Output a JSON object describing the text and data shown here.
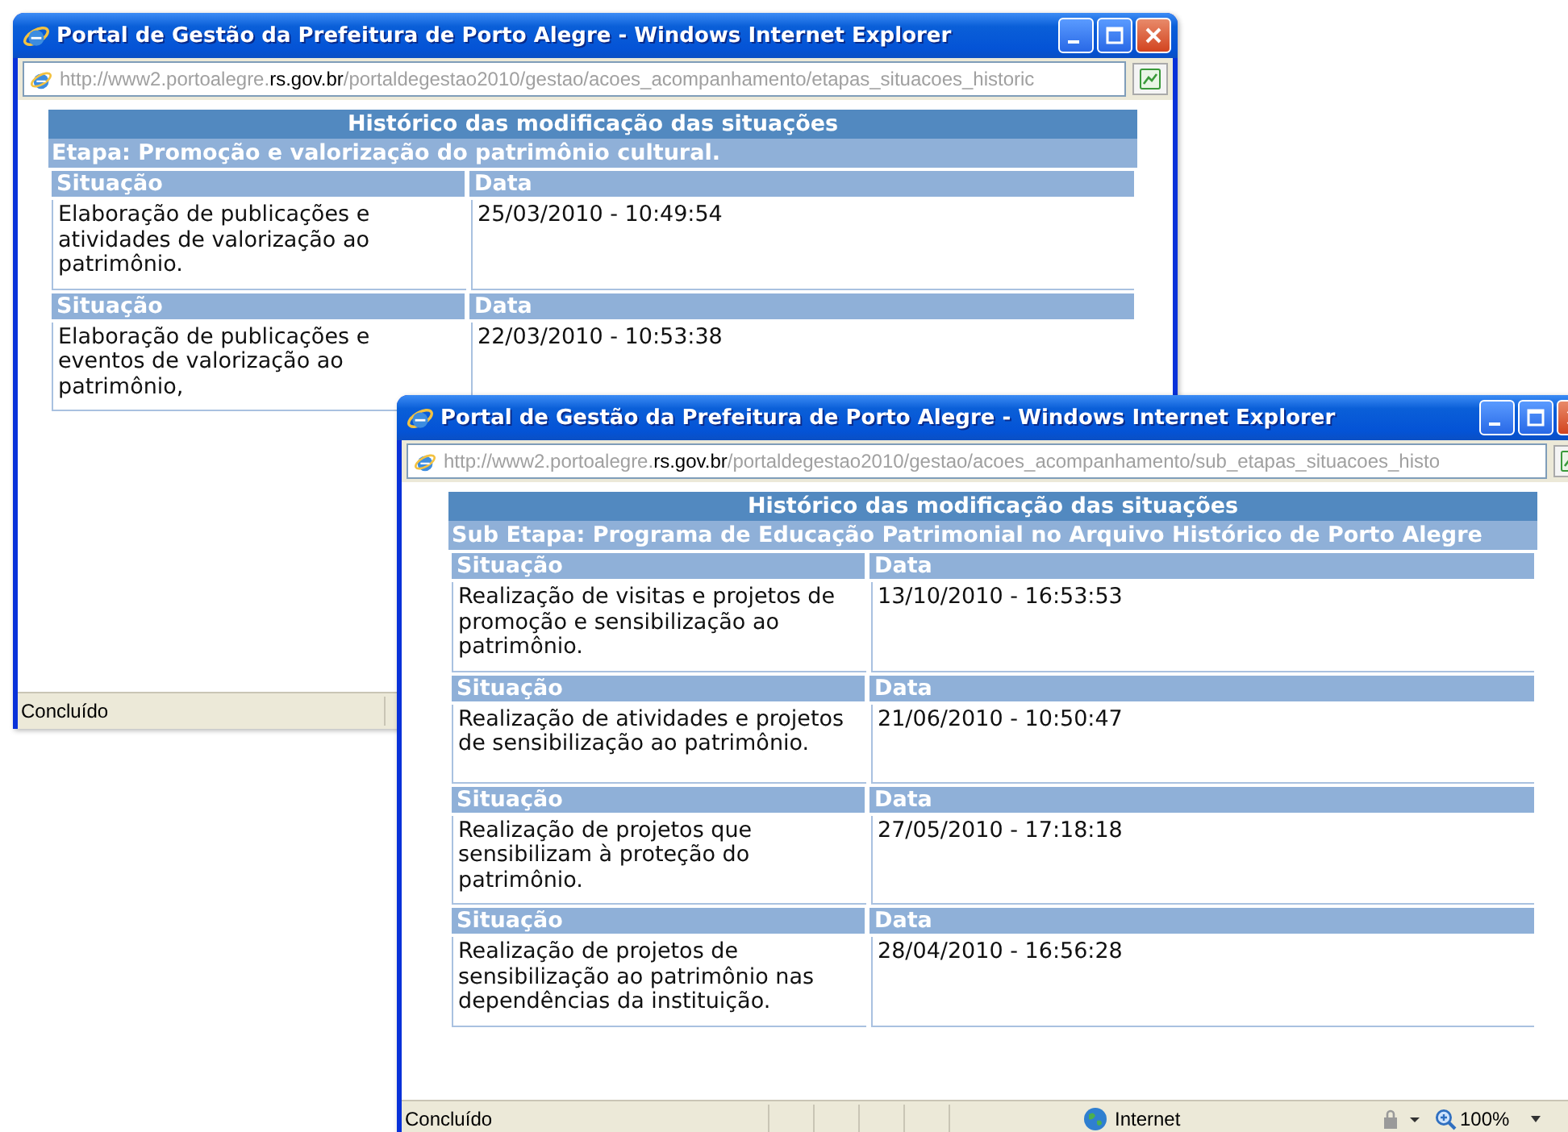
{
  "windows": [
    {
      "title": "Portal de Gestão da Prefeitura de Porto Alegre - Windows Internet Explorer",
      "address": {
        "prefix": "http://www2.portoalegre.",
        "domain": "rs.gov.br",
        "path": "/portaldegestao2010/gestao/acoes_acompanhamento/etapas_situacoes_historic"
      },
      "heading": "Histórico das modificação das situações",
      "stage": "Etapa: Promoção e valorização do patrimônio cultural.",
      "entries": [
        {
          "situation_label": "Situação",
          "date_label": "Data",
          "situation": "Elaboração de publicações e atividades de valorização ao patrimônio.",
          "date": "25/03/2010 - 10:49:54"
        },
        {
          "situation_label": "Situação",
          "date_label": "Data",
          "situation": "Elaboração de publicações e eventos de valorização ao patrimônio,",
          "date": "22/03/2010 - 10:53:38"
        }
      ],
      "status_bar": {
        "text": "Concluído"
      }
    },
    {
      "title": "Portal de Gestão da Prefeitura de Porto Alegre - Windows Internet Explorer",
      "address": {
        "prefix": "http://www2.portoalegre.",
        "domain": "rs.gov.br",
        "path": "/portaldegestao2010/gestao/acoes_acompanhamento/sub_etapas_situacoes_histo"
      },
      "heading": "Histórico das modificação das situações",
      "stage": "Sub Etapa: Programa de Educação Patrimonial no Arquivo Histórico de Porto Alegre",
      "entries": [
        {
          "situation_label": "Situação",
          "date_label": "Data",
          "situation": "Realização de visitas e projetos de promoção e sensibilização ao patrimônio.",
          "date": "13/10/2010 - 16:53:53"
        },
        {
          "situation_label": "Situação",
          "date_label": "Data",
          "situation": "Realização de atividades e projetos de sensibilização ao patrimônio.",
          "date": "21/06/2010 - 10:50:47"
        },
        {
          "situation_label": "Situação",
          "date_label": "Data",
          "situation": "Realização de projetos que sensibilizam à proteção do patrimônio.",
          "date": "27/05/2010 - 17:18:18"
        },
        {
          "situation_label": "Situação",
          "date_label": "Data",
          "situation": "Realização de projetos de sensibilização ao patrimônio nas dependências da instituição.",
          "date": "28/04/2010 - 16:56:28"
        }
      ],
      "status_bar": {
        "text": "Concluído",
        "zone": "Internet",
        "zoom": "100%"
      }
    }
  ]
}
